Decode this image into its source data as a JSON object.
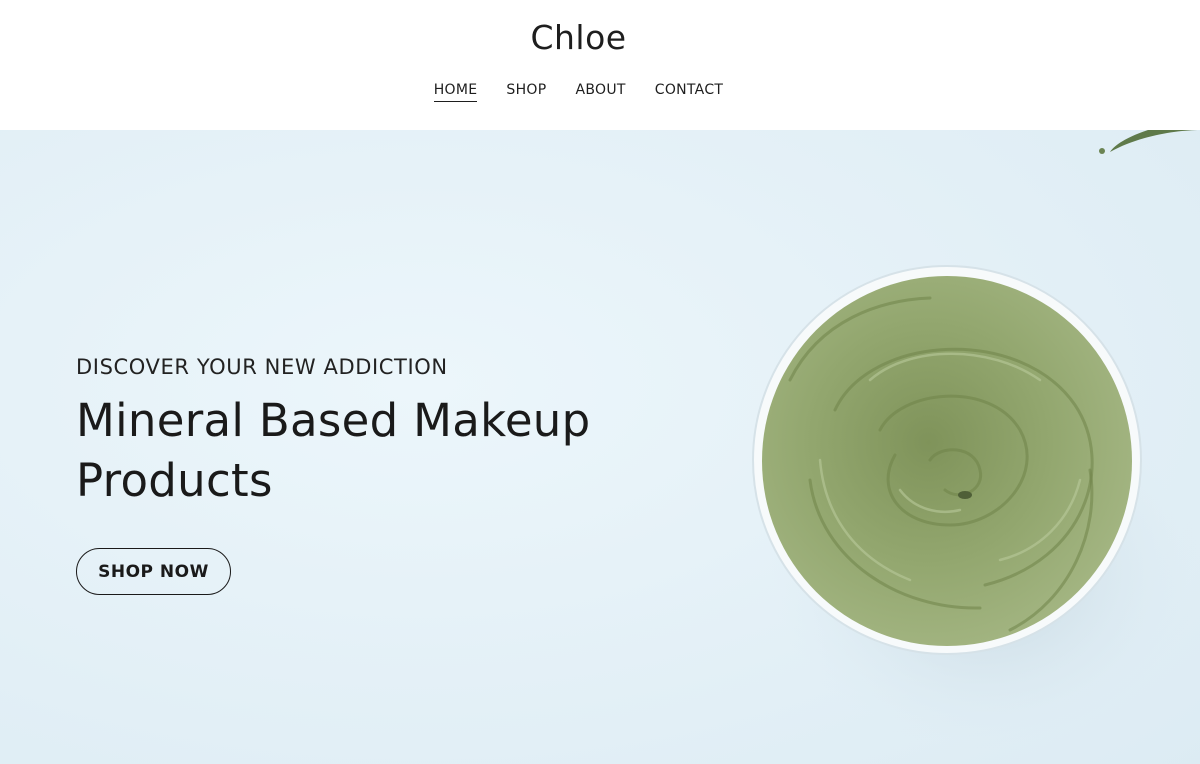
{
  "header": {
    "site_title": "Chloe",
    "nav": [
      {
        "label": "HOME",
        "active": true
      },
      {
        "label": "SHOP",
        "active": false
      },
      {
        "label": "ABOUT",
        "active": false
      },
      {
        "label": "CONTACT",
        "active": false
      }
    ]
  },
  "hero": {
    "eyebrow": "DISCOVER YOUR NEW ADDICTION",
    "headline_line1": "Mineral Based Makeup",
    "headline_line2": "Products",
    "cta_label": "SHOP NOW"
  },
  "colors": {
    "hero_background": "#e6f2f8",
    "clay_green": "#8fa36a",
    "text": "#1a1a1a"
  }
}
